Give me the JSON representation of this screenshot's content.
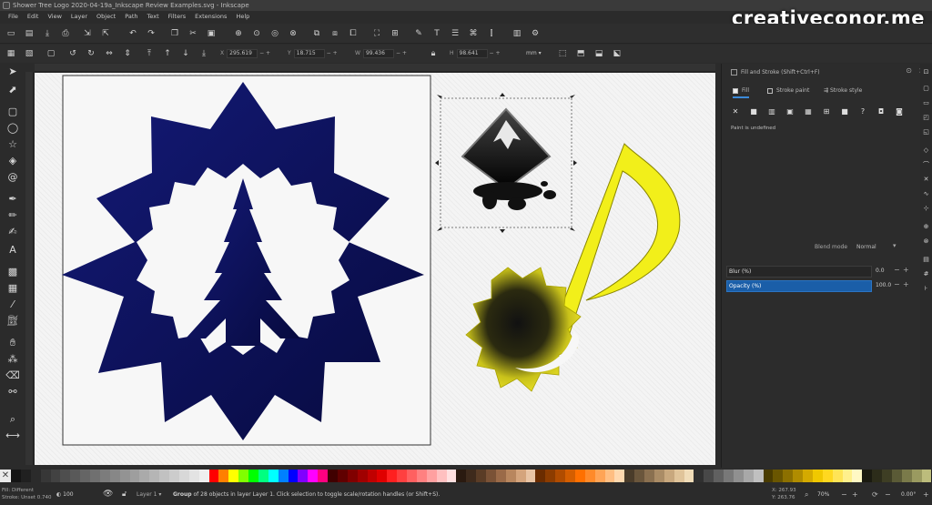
{
  "titlebar": {
    "title": "Shower Tree Logo 2020-04-19a_Inkscape Review Examples.svg - Inkscape"
  },
  "watermark": {
    "text": "creativeconor.me"
  },
  "menu": [
    "File",
    "Edit",
    "View",
    "Layer",
    "Object",
    "Path",
    "Text",
    "Filters",
    "Extensions",
    "Help"
  ],
  "controls": {
    "x_label": "X",
    "x_value": "295.619",
    "y_label": "Y",
    "y_value": "18.715",
    "w_label": "W",
    "w_value": "99.436",
    "h_label": "H",
    "h_value": "98.641",
    "unit": "mm"
  },
  "panel": {
    "title": "Fill and Stroke (Shift+Ctrl+F)",
    "tabs": [
      "Fill",
      "Stroke paint",
      "Stroke style"
    ],
    "paint_status": "Paint is undefined",
    "blend_label": "Blend mode",
    "blend_value": "Normal",
    "blur_label": "Blur (%)",
    "blur_value": "0.0",
    "opacity_label": "Opacity (%)",
    "opacity_value": "100.0"
  },
  "status": {
    "fill_label": "Fill:",
    "fill_value": "Different",
    "stroke_label": "Stroke:",
    "stroke_value": "Unset 0.740",
    "opacity_value": "100",
    "layer_value": "Layer 1",
    "message_bold": "Group",
    "message": " of 28 objects in layer Layer 1. Click selection to toggle scale/rotation handles (or Shift+S).",
    "coord_x": "X: 267.93",
    "coord_y": "Y: 263.76",
    "zoom_value": "70%",
    "rotation_value": "0.00°"
  },
  "colors": {
    "accent": "#1a5ea8",
    "star_fill": "#0d1260",
    "note_fill": "#f2ef1a",
    "canvas": "#f4f4f4"
  }
}
